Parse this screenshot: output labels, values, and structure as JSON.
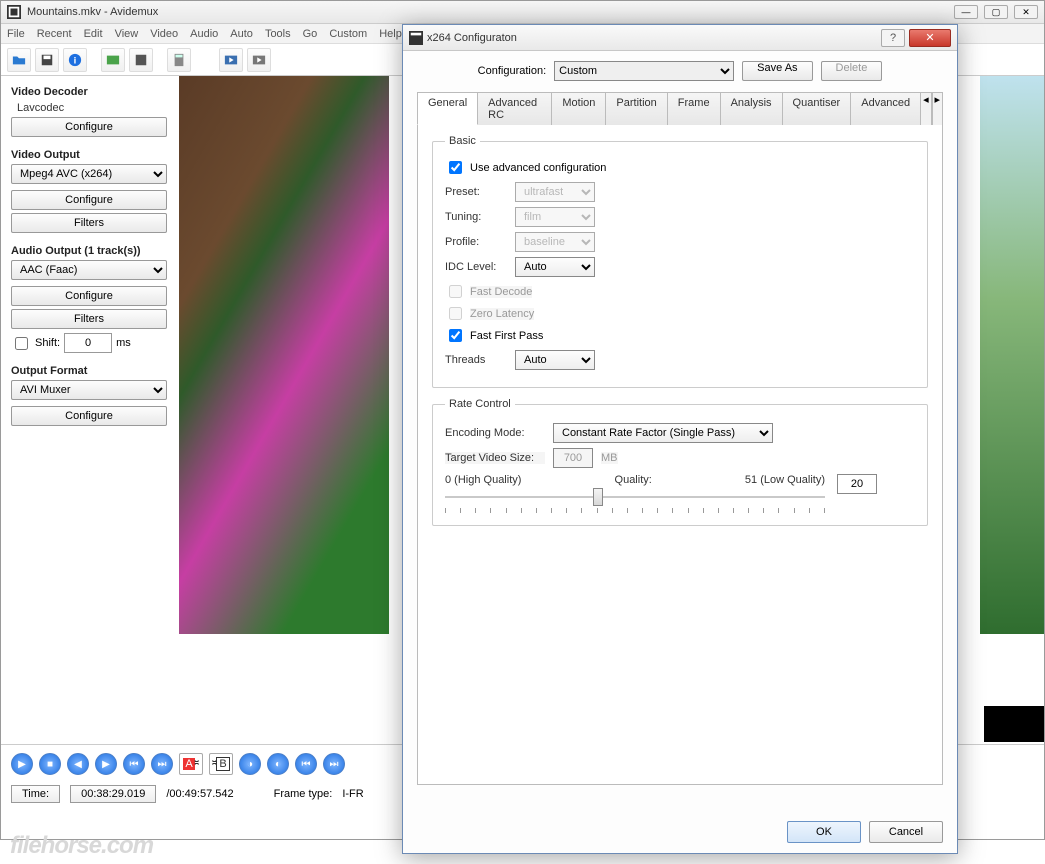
{
  "window": {
    "title": "Mountains.mkv - Avidemux"
  },
  "menu": [
    "File",
    "Recent",
    "Edit",
    "View",
    "Video",
    "Audio",
    "Auto",
    "Tools",
    "Go",
    "Custom",
    "Help"
  ],
  "sidebar": {
    "video_decoder": {
      "title": "Video Decoder",
      "codec": "Lavcodec",
      "configure": "Configure"
    },
    "video_output": {
      "title": "Video Output",
      "codec": "Mpeg4 AVC (x264)",
      "configure": "Configure",
      "filters": "Filters"
    },
    "audio_output": {
      "title": "Audio Output (1 track(s))",
      "codec": "AAC (Faac)",
      "configure": "Configure",
      "filters": "Filters",
      "shift_label": "Shift:",
      "shift_value": "0",
      "shift_unit": "ms"
    },
    "output_format": {
      "title": "Output Format",
      "container": "AVI Muxer",
      "configure": "Configure"
    }
  },
  "timeline": {
    "time_label": "Time:",
    "time_value": "00:38:29.019",
    "duration": "/00:49:57.542",
    "frame_type_label": "Frame type:",
    "frame_type_value": "I-FR"
  },
  "dialog": {
    "title": "x264 Configuraton",
    "config_label": "Configuration:",
    "config_value": "Custom",
    "save_as": "Save As",
    "delete": "Delete",
    "tabs": [
      "General",
      "Advanced RC",
      "Motion",
      "Partition",
      "Frame",
      "Analysis",
      "Quantiser",
      "Advanced"
    ],
    "basic": {
      "legend": "Basic",
      "use_advanced": "Use advanced configuration",
      "preset_label": "Preset:",
      "preset_value": "ultrafast",
      "tuning_label": "Tuning:",
      "tuning_value": "film",
      "profile_label": "Profile:",
      "profile_value": "baseline",
      "idc_label": "IDC Level:",
      "idc_value": "Auto",
      "fast_decode": "Fast Decode",
      "zero_latency": "Zero Latency",
      "fast_first_pass": "Fast First Pass",
      "threads_label": "Threads",
      "threads_value": "Auto"
    },
    "rate": {
      "legend": "Rate Control",
      "mode_label": "Encoding Mode:",
      "mode_value": "Constant Rate Factor (Single Pass)",
      "target_label": "Target Video Size:",
      "target_value": "700",
      "target_unit": "MB",
      "q_low": "0 (High Quality)",
      "q_mid": "Quality:",
      "q_high": "51 (Low Quality)",
      "q_value": "20"
    },
    "ok": "OK",
    "cancel": "Cancel"
  },
  "watermark": "filehorse.com"
}
